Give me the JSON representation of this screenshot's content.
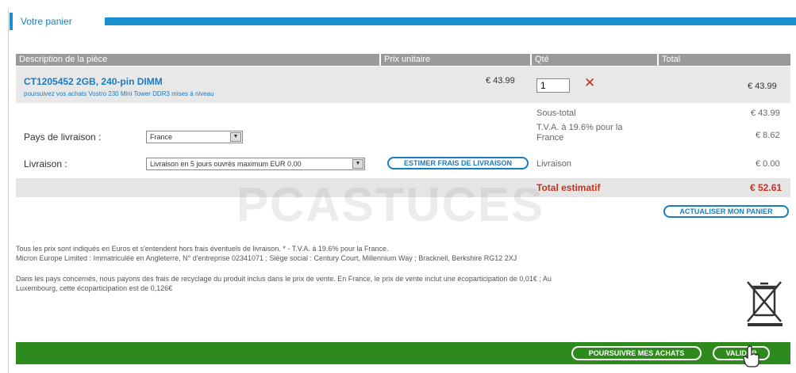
{
  "page_title": "Votre panier",
  "table": {
    "headers": [
      "Description de la pièce",
      "Prix unitaire",
      "Qté",
      "Total"
    ]
  },
  "product": {
    "name": "CT1205452 2GB, 240-pin DIMM",
    "subtitle": "poursuivez vos achats Vostro 230 Mini Tower DDR3 mises à niveau",
    "unit_price": "€ 43.99",
    "quantity": "1",
    "line_total": "€ 43.99"
  },
  "summary": {
    "subtotal_label": "Sous-total",
    "subtotal_value": "€ 43.99",
    "vat_label": "T.V.A. à 19.6% pour la France",
    "vat_value": "€ 8.62",
    "delivery_label": "Livraison",
    "delivery_value": "€ 0.00",
    "total_label": "Total estimatif",
    "total_value": "€ 52.61"
  },
  "form": {
    "country_label": "Pays de livraison :",
    "country_value": "France",
    "delivery_label": "Livraison :",
    "delivery_value": "Livraison en 5 jours ouvrés maximum EUR 0.00"
  },
  "buttons": {
    "estimate": "ESTIMER FRAIS DE LIVRAISON",
    "update": "ACTUALISER MON PANIER",
    "continue": "POURSUIVRE MES ACHATS",
    "validate": "VALIDER"
  },
  "watermark": "PCASTUCES",
  "notes": {
    "line1": "Tous les prix sont indiqués en Euros et s'entendent hors frais éventuels de livraison. * - T.V.A. à 19.6% pour la France.",
    "line2": "Micron Europe Limited : Immatriculée en Angleterre, N° d'entreprise 02341071 ; Siège social : Century Court, Millennium Way ; Bracknell, Berkshire RG12 2XJ",
    "line3": "Dans les pays concernés, nous payons des frais de recyclage du produit inclus dans le prix de vente. En France, le prix de vente inclut une écoparticipation de 0,01€ ; Au",
    "line4": "Luxembourg, cette écoparticipation est de 0,126€"
  },
  "colors": {
    "accent": "#1a8fd0",
    "total": "#c8331f",
    "footer": "#2f8a1e"
  },
  "icons": [
    "remove-icon",
    "dropdown-arrow-icon",
    "recycle-bin-crossed-icon",
    "hand-cursor-icon"
  ]
}
